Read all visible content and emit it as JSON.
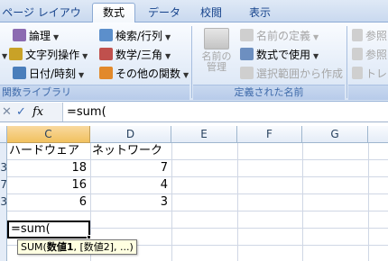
{
  "ribbon_tabs": [
    {
      "label": "ページ レイアウト"
    },
    {
      "label": "数式"
    },
    {
      "label": "データ"
    },
    {
      "label": "校閲"
    },
    {
      "label": "表示"
    }
  ],
  "function_library": {
    "caption": "関数ライブラリ",
    "logical": "論理",
    "text": "文字列操作",
    "datetime": "日付/時刻",
    "lookup": "検索/行列",
    "math": "数学/三角",
    "more": "その他の関数"
  },
  "defined_names": {
    "caption": "定義された名前",
    "name_manager": "名前の\n管理",
    "define_name": "名前の定義",
    "use_in_formula": "数式で使用",
    "create_from_selection": "選択範囲から作成"
  },
  "formula_auditing": {
    "trace_precedents": "参照",
    "trace_dependents": "参照",
    "remove_arrows": "トレ"
  },
  "formula_bar": {
    "cancel_symbol": "✕",
    "enter_symbol": "✓",
    "fx_symbol": "fx",
    "value": "=sum("
  },
  "columns": [
    "C",
    "D",
    "E",
    "F",
    "G"
  ],
  "header_row": {
    "c": "ハードウェア",
    "d": "ネットワーク"
  },
  "rows": [
    {
      "rowno": "3",
      "c": "18",
      "d": "7"
    },
    {
      "rowno": "7",
      "c": "16",
      "d": "4"
    },
    {
      "rowno": "3",
      "c": "6",
      "d": "3"
    }
  ],
  "active_cell_value": "=sum(",
  "tooltip": {
    "func": "SUM(",
    "arg1": "数値1",
    "rest": ", [数値2], ...)"
  },
  "colors": {
    "ribbon_text": "#15428b",
    "selected_column": "#f1c15f",
    "tooltip_bg": "#ffffe1"
  }
}
